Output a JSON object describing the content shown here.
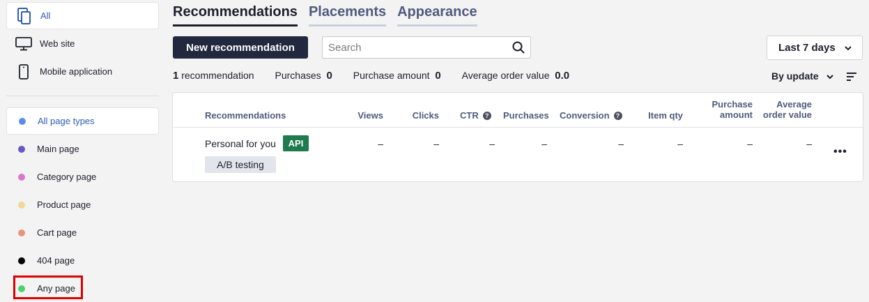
{
  "sidebar": {
    "sources": [
      {
        "label": "All",
        "icon": "devices-icon"
      },
      {
        "label": "Web site",
        "icon": "monitor-icon"
      },
      {
        "label": "Mobile application",
        "icon": "phone-icon"
      }
    ],
    "page_types": [
      {
        "label": "All page types",
        "color": "#5b8def"
      },
      {
        "label": "Main page",
        "color": "#6a56c5"
      },
      {
        "label": "Category page",
        "color": "#d97ac9"
      },
      {
        "label": "Product page",
        "color": "#f2d894"
      },
      {
        "label": "Cart page",
        "color": "#e3987a"
      },
      {
        "label": "404 page",
        "color": "#000000"
      },
      {
        "label": "Any page",
        "color": "#4cd36b"
      }
    ]
  },
  "tabs": [
    "Recommendations",
    "Placements",
    "Appearance"
  ],
  "toolbar": {
    "new_label": "New recommendation",
    "search_placeholder": "Search",
    "date_range": "Last 7 days"
  },
  "stats": {
    "count": "1",
    "count_label": "recommendation",
    "purchases_label": "Purchases",
    "purchases": "0",
    "amount_label": "Purchase amount",
    "amount": "0",
    "aov_label": "Average order value",
    "aov": "0.0",
    "sort_label": "By update"
  },
  "table": {
    "headers": {
      "name": "Recommendations",
      "views": "Views",
      "clicks": "Clicks",
      "ctr": "CTR",
      "purchases": "Purchases",
      "conversion": "Conversion",
      "item_qty": "Item qty",
      "amount_1": "Purchase",
      "amount_2": "amount",
      "aov_1": "Average",
      "aov_2": "order value"
    },
    "row": {
      "name": "Personal for you",
      "badge": "API",
      "tag": "A/B testing",
      "views": "–",
      "clicks": "–",
      "ctr": "–",
      "purchases": "–",
      "conversion": "–",
      "item_qty": "–",
      "amount": "–",
      "aov": "–",
      "more": "•••"
    }
  },
  "colors": {
    "accent": "#2f5bb7",
    "primary_button": "#22283e",
    "api_badge": "#1f7a4d",
    "highlight": "#e00000"
  }
}
